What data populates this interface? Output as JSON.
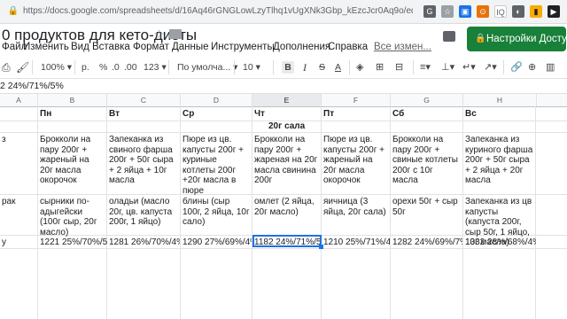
{
  "browser": {
    "url": "https://docs.google.com/spreadsheets/d/16Aq46rGNGLowLzyTlhq1vUgXNk3Gbp_kEzcJcr0Aq9o/edit#gid=3...",
    "lock_icon": "lock-icon"
  },
  "doc": {
    "title": "0 продуктов для кето-диеты",
    "share_label": "Настройки Доступа"
  },
  "menu": [
    "Файл",
    "Изменить",
    "Вид",
    "Вставка",
    "Формат",
    "Данные",
    "Инструменты",
    "Дополнения",
    "Справка"
  ],
  "last_edit": "Все измен...",
  "toolbar": {
    "zoom": "100%",
    "currency": "р.",
    "percent": "%",
    "dec1": ".0",
    "dec2": ".00",
    "numfmt": "123",
    "font": "По умолча...",
    "fontsize": "10",
    "bold": "B",
    "italic": "I",
    "strike": "S",
    "textcolor": "A"
  },
  "formula_bar": {
    "value": "2 24%/71%/5%"
  },
  "columns": [
    "A",
    "B",
    "C",
    "D",
    "E",
    "F",
    "G",
    "H"
  ],
  "selected_column": "E",
  "rows": {
    "days": [
      "Пн",
      "Вт",
      "Ср",
      "Чт",
      "Пт",
      "Сб",
      "Вс"
    ],
    "merged_label": "20г сала",
    "row3_a": "з",
    "lunch": [
      "Брокколи на пару 200г + жареный на 20г масла окорочок",
      "Запеканка из свиного фарша 200г + 50г сыра + 2 яйца + 10г масла",
      "Пюре из цв. капусты 200г + куриные котлеты 200г +20г масла в пюре",
      "Брокколи на пару 200г + жареная на 20г масла свинина 200г",
      "Пюре из цв. капусты 200г + жареный на 20г масла окорочок",
      "Брокколи на пару 200г + свиные котлеты 200г с 10г масла",
      "Запеканка из куриного фарша 200г + 50г сыра + 2 яйца + 20г масла"
    ],
    "row4_a": "рак",
    "breakfast": [
      "сырники по-адыгейски (100г сыр, 20г масло)",
      "оладьи (масло 20г, цв. капуста 200г, 1 яйцо)",
      "блины (сыр 100г, 2 яйца, 10г сало)",
      "омлет (2 яйца, 20г масло)",
      "яичница (3 яйца, 20г сала)",
      "орехи 50г + сыр 50г",
      "Запеканка из цв капусты (капуста 200г, сыр 50г, 1 яйцо, 10г масла)"
    ],
    "row5_a": "у",
    "totals": [
      "1221 25%/70%/5%",
      "1281 26%/70%/4%",
      "1290 27%/69%/4%",
      "1182 24%/71%/5%",
      "1210 25%/71%/4%",
      "1282 24%/69%/7%",
      "1332 28%/68%/4%"
    ]
  }
}
